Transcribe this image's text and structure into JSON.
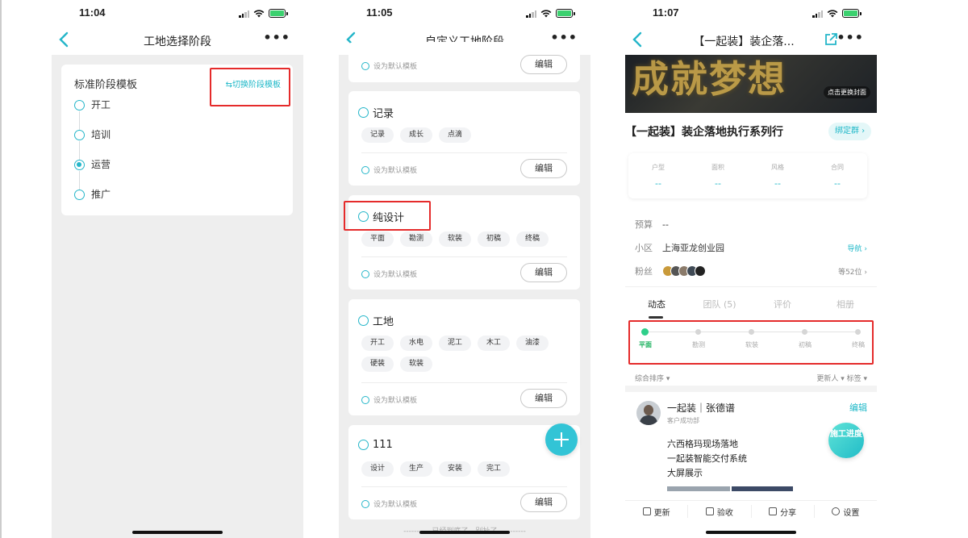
{
  "colors": {
    "accent": "#25b6c9",
    "highlight_box": "#e52b2b",
    "active_stage": "#2fcf8a"
  },
  "phone1": {
    "time": "11:04",
    "nav_title": "工地选择阶段",
    "card_title": "标准阶段模板",
    "switch_link": "⇆切换阶段模板",
    "options": [
      {
        "label": "开工",
        "selected": false
      },
      {
        "label": "培训",
        "selected": false
      },
      {
        "label": "运营",
        "selected": true
      },
      {
        "label": "推广",
        "selected": false
      }
    ]
  },
  "phone2": {
    "time": "11:05",
    "nav_title": "自定义工地阶段",
    "set_default_label": "设为默认模板",
    "edit_label": "编辑",
    "templates": [
      {
        "name": "记录",
        "tags": [
          "记录",
          "成长",
          "点滴"
        ]
      },
      {
        "name": "纯设计",
        "tags": [
          "平面",
          "勘测",
          "软装",
          "初稿",
          "终稿"
        ]
      },
      {
        "name": "工地",
        "tags": [
          "开工",
          "水电",
          "泥工",
          "木工",
          "油漆",
          "硬装",
          "软装"
        ]
      },
      {
        "name": "111",
        "tags": [
          "设计",
          "生产",
          "安装",
          "完工"
        ]
      }
    ],
    "bottom_tip": "---------- 已经到底了，别扯了 ----------"
  },
  "phone3": {
    "time": "11:07",
    "nav_title": "【一起装】装企落...",
    "cover_text": "成就梦想",
    "cover_hint": "点击更换封面",
    "project_title": "【一起装】装企落地执行系列行",
    "bind_group": "绑定群 ›",
    "stats": [
      {
        "label": "户型",
        "value": "--"
      },
      {
        "label": "面积",
        "value": "--"
      },
      {
        "label": "风格",
        "value": "--"
      },
      {
        "label": "合同",
        "value": "--"
      }
    ],
    "budget": {
      "label": "预算",
      "value": "--"
    },
    "community": {
      "label": "小区",
      "value": "上海亚龙创业园",
      "action": "导航 ›"
    },
    "fans": {
      "label": "粉丝",
      "count": "等52位 ›"
    },
    "tabs": [
      "动态",
      "团队 (5)",
      "评价",
      "相册"
    ],
    "stages": [
      {
        "label": "平面",
        "active": true
      },
      {
        "label": "勘测",
        "active": false
      },
      {
        "label": "软装",
        "active": false
      },
      {
        "label": "初稿",
        "active": false
      },
      {
        "label": "终稿",
        "active": false
      }
    ],
    "sort": {
      "left": "综合排序 ▾",
      "right": "更新人 ▾   标签 ▾"
    },
    "post": {
      "name": "一起装｜张德谱",
      "role": "客户成功部",
      "edit": "编辑",
      "lines": [
        "六西格玛现场落地",
        "一起装智能交付系统",
        "大屏展示"
      ]
    },
    "float_btn": "施工进度",
    "bottom_bar": [
      {
        "icon": "edit-icon",
        "label": "更新"
      },
      {
        "icon": "checklist-icon",
        "label": "验收"
      },
      {
        "icon": "share-icon",
        "label": "分享"
      },
      {
        "icon": "gear-icon",
        "label": "设置"
      }
    ]
  }
}
